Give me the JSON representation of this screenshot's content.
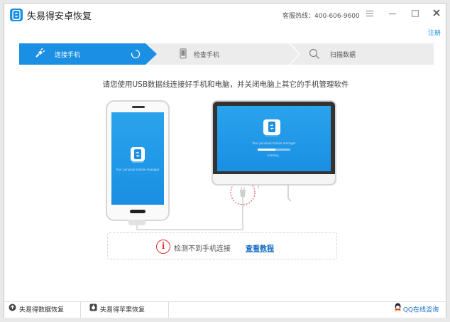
{
  "titlebar": {
    "title": "失易得安卓恢复",
    "hotline": "客服热线：400-606-9600",
    "menu_icon": "menu-icon",
    "minimize_icon": "minimize-icon",
    "maximize_icon": "maximize-icon",
    "close_icon": "close-icon"
  },
  "register_label": "注册",
  "steps": [
    {
      "label": "连接手机",
      "icon": "usb-plug-icon",
      "active": true
    },
    {
      "label": "检查手机",
      "icon": "phone-outline-icon",
      "active": false
    },
    {
      "label": "扫描数据",
      "icon": "search-icon",
      "active": false
    }
  ],
  "instruction": "请您使用USB数据线连接好手机和电脑，并关闭电脑上其它的手机管理软件",
  "illustration": {
    "phone_caption": "Your personal mobile manager",
    "monitor_caption": "Your personal mobile manager",
    "monitor_loading": "Loading...",
    "monitor_progress": 0.55
  },
  "status": {
    "icon_glyph": "i",
    "message": "检测不到手机连接",
    "link_label": "查看教程"
  },
  "footer": {
    "items": [
      {
        "label": "失易得数据恢复",
        "icon": "data-recovery-icon"
      },
      {
        "label": "失易得苹果恢复",
        "icon": "apple-recovery-icon"
      }
    ],
    "qq_label": "QQ在线咨询"
  },
  "colors": {
    "accent": "#1a8fe3",
    "inactive_step": "#ececec",
    "warning": "#e03030",
    "link": "#1a6fc4"
  }
}
